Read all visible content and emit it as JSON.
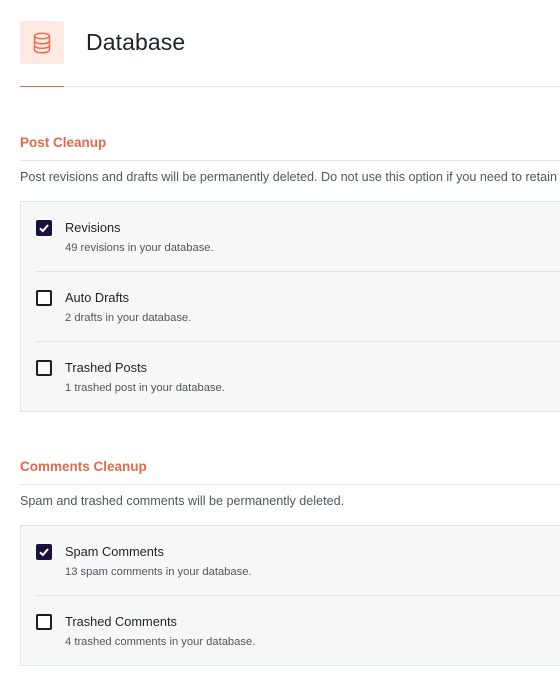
{
  "header": {
    "title": "Database",
    "icon": "database-icon",
    "accent_color": "#e96d4b"
  },
  "post_cleanup": {
    "title": "Post Cleanup",
    "description": "Post revisions and drafts will be permanently deleted. Do not use this option if you need to retain",
    "options": [
      {
        "label": "Revisions",
        "description": "49 revisions in your database.",
        "checked": true
      },
      {
        "label": "Auto Drafts",
        "description": "2 drafts in your database.",
        "checked": false
      },
      {
        "label": "Trashed Posts",
        "description": "1 trashed post in your database.",
        "checked": false
      }
    ]
  },
  "comments_cleanup": {
    "title": "Comments Cleanup",
    "description": "Spam and trashed comments will be permanently deleted.",
    "options": [
      {
        "label": "Spam Comments",
        "description": "13 spam comments in your database.",
        "checked": true
      },
      {
        "label": "Trashed Comments",
        "description": "4 trashed comments in your database.",
        "checked": false
      }
    ]
  },
  "colors": {
    "section_title": "#e5694a",
    "checkbox_checked": "#1c0f3c",
    "panel_bg": "#f6f7f7"
  }
}
